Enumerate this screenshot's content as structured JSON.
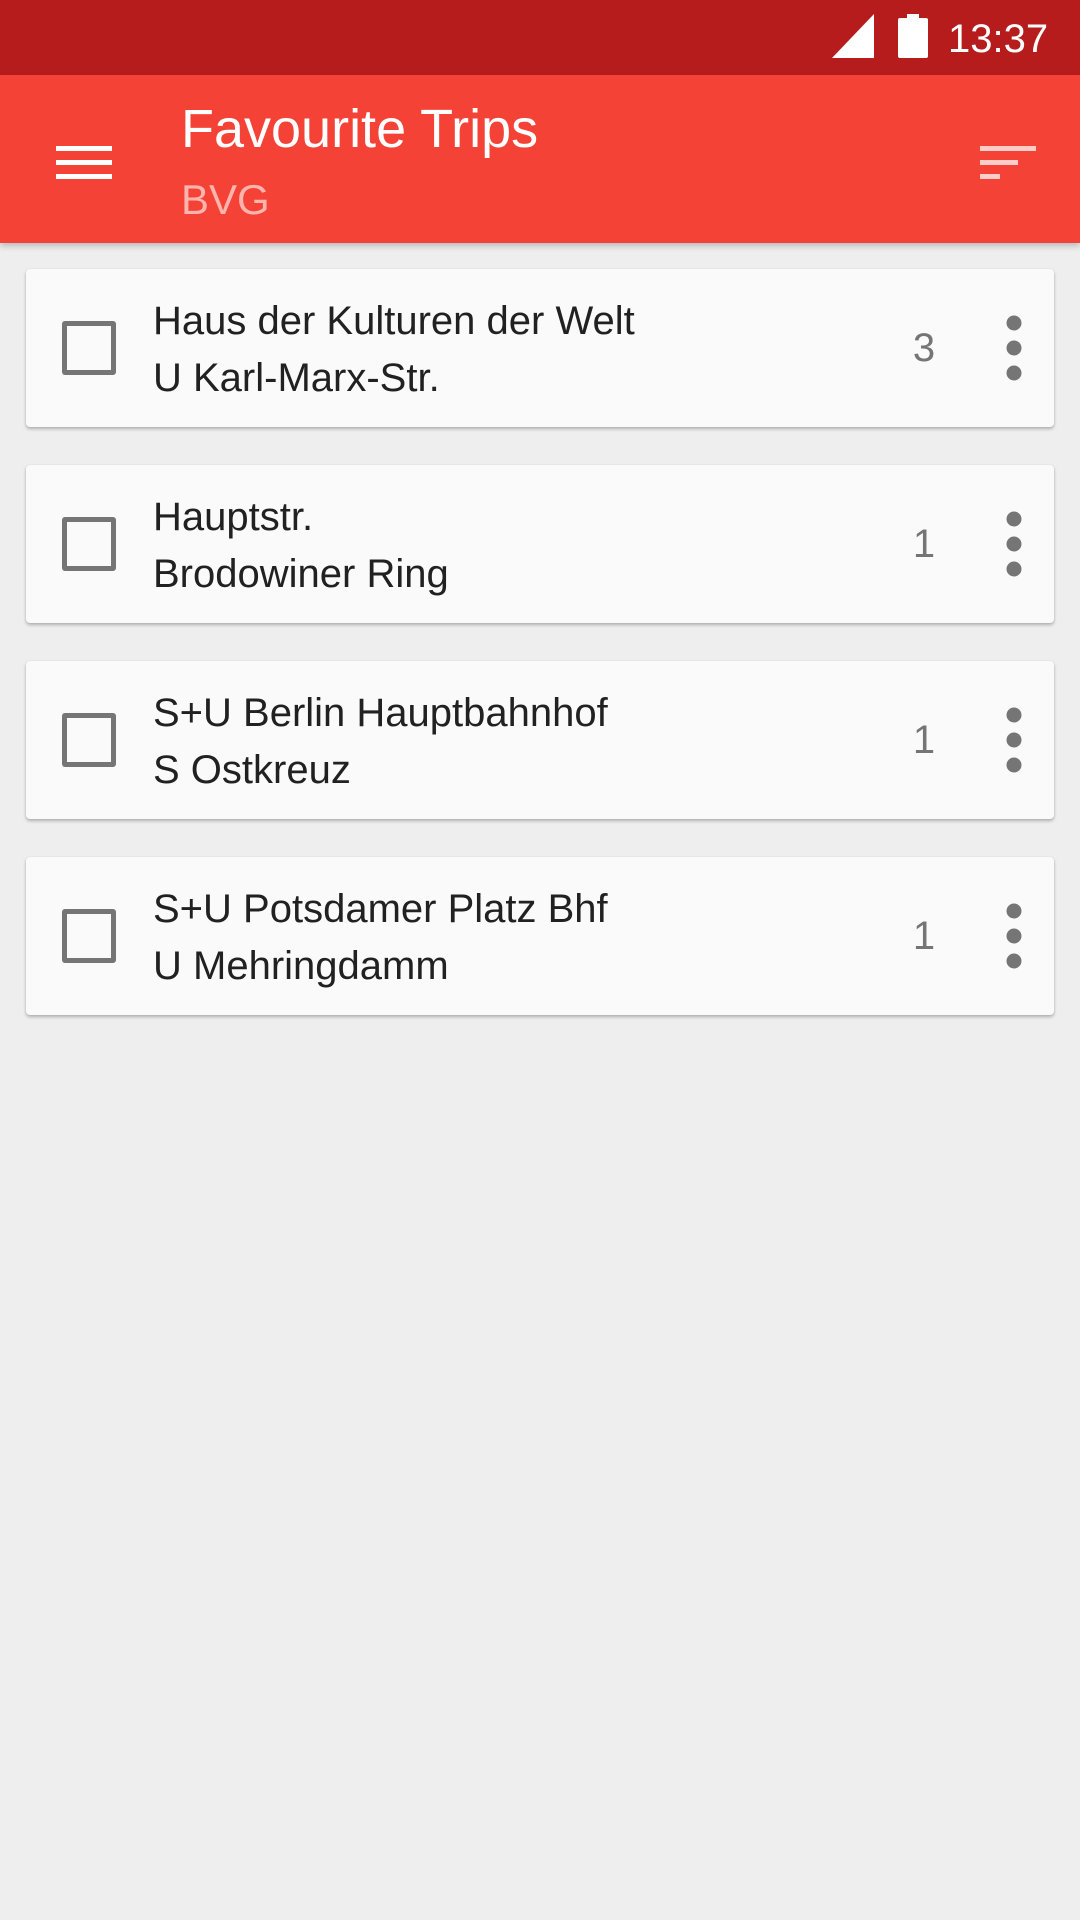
{
  "status_bar": {
    "time": "13:37",
    "icons": [
      "signal-icon",
      "battery-icon"
    ],
    "color": "#b71c1c"
  },
  "app_bar": {
    "title": "Favourite Trips",
    "subtitle": "BVG",
    "color": "#f44336",
    "icons": [
      "menu-icon",
      "sort-icon"
    ]
  },
  "trips": [
    {
      "from": "Haus der Kulturen der Welt",
      "to": "U Karl-Marx-Str.",
      "count": "3",
      "checked": false
    },
    {
      "from": "Hauptstr.",
      "to": "Brodowiner Ring",
      "count": "1",
      "checked": false
    },
    {
      "from": "S+U Berlin Hauptbahnhof",
      "to": "S Ostkreuz",
      "count": "1",
      "checked": false
    },
    {
      "from": "S+U Potsdamer Platz Bhf",
      "to": "U Mehringdamm",
      "count": "1",
      "checked": false
    }
  ]
}
